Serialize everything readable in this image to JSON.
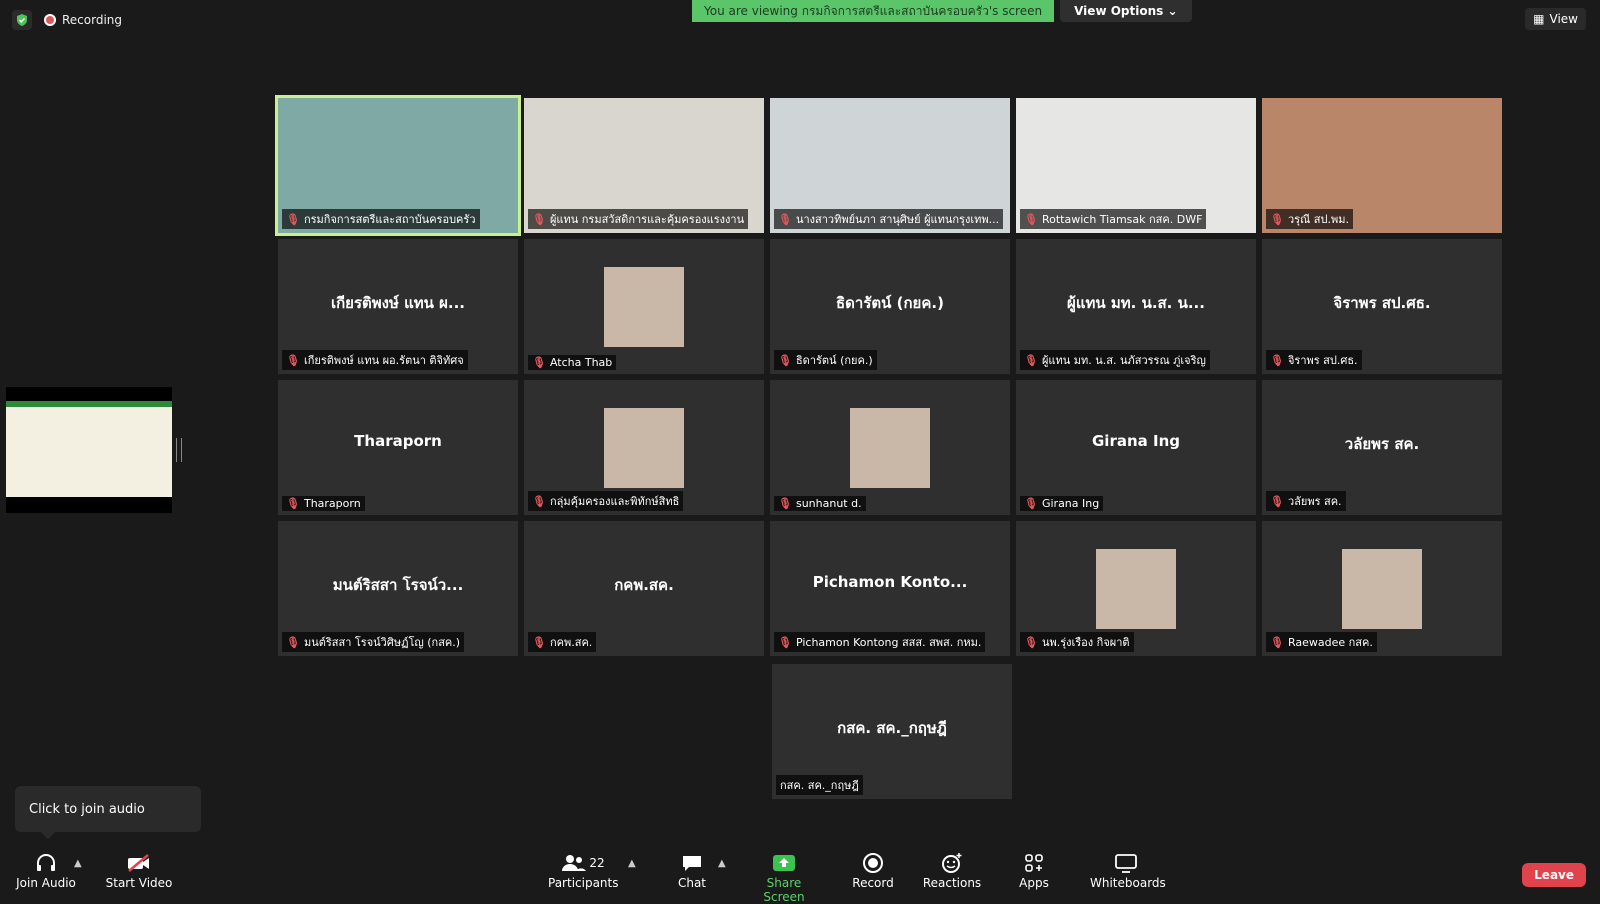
{
  "top": {
    "recording_label": "Recording",
    "banner_message": "You are viewing กรมกิจการสตรีและสถาบันครอบครัว's screen",
    "view_options_label": "View Options",
    "view_label": "View"
  },
  "tiles": [
    {
      "label": "กรมกิจการสตรีและสถาบันครอบครัว",
      "big": "",
      "kind": "video"
    },
    {
      "label": "ผู้แทน กรมสวัสดิการและคุ้มครองแรงงาน",
      "big": "",
      "kind": "video"
    },
    {
      "label": "นางสาวทิพย์นภา สานุศิษย์ ผู้แทนกรุงเทพ...",
      "big": "",
      "kind": "video"
    },
    {
      "label": "Rottawich Tiamsak กสค. DWF",
      "big": "",
      "kind": "video"
    },
    {
      "label": "วรุณี สป.พม.",
      "big": "",
      "kind": "video"
    },
    {
      "label": "เกียรติพงษ์ แทน ผอ.รัตนา ติจิทัศจ",
      "big": "เกียรติพงษ์ แทน ผ...",
      "kind": "name"
    },
    {
      "label": "Atcha Thab",
      "big": "",
      "kind": "avatar"
    },
    {
      "label": "ธิดารัตน์ (กยค.)",
      "big": "ธิดารัตน์ (กยค.)",
      "kind": "name"
    },
    {
      "label": "ผู้แทน มท. น.ส. นภัสวรรณ ภู่เจริญ",
      "big": "ผู้แทน มท. น.ส. น...",
      "kind": "name"
    },
    {
      "label": "จิราพร สป.ศธ.",
      "big": "จิราพร สป.ศธ.",
      "kind": "name"
    },
    {
      "label": "Tharaporn",
      "big": "Tharaporn",
      "kind": "name"
    },
    {
      "label": "กลุ่มคุ้มครองและพิทักษ์สิทธิ",
      "big": "",
      "kind": "avatar"
    },
    {
      "label": "sunhanut d.",
      "big": "",
      "kind": "avatar"
    },
    {
      "label": "Girana Ing",
      "big": "Girana Ing",
      "kind": "name"
    },
    {
      "label": "วลัยพร สค.",
      "big": "วลัยพร สค.",
      "kind": "name"
    },
    {
      "label": "มนต์ริสสา โรจน์วิศิษฏ์โญ (กสค.)",
      "big": "มนต์ริสสา โรจน์ว...",
      "kind": "name"
    },
    {
      "label": "กคพ.สค.",
      "big": "กคพ.สค.",
      "kind": "name"
    },
    {
      "label": "Pichamon Kontong สสส. สพส. กหม.",
      "big": "Pichamon Konto...",
      "kind": "name"
    },
    {
      "label": "นพ.รุ่งเรือง กิจผาติ",
      "big": "",
      "kind": "avatar"
    },
    {
      "label": "Raewadee กสค.",
      "big": "",
      "kind": "avatar"
    }
  ],
  "last_tile": {
    "label": "กสค. สค._กฤษฎี",
    "big": "กสค. สค._กฤษฎี"
  },
  "audio_tip": "Click to join audio",
  "toolbar": {
    "join_audio": "Join Audio",
    "start_video": "Start Video",
    "participants": "Participants",
    "participants_count": "22",
    "chat": "Chat",
    "share_screen": "Share Screen",
    "record": "Record",
    "reactions": "Reactions",
    "apps": "Apps",
    "whiteboards": "Whiteboards",
    "leave": "Leave"
  },
  "colors": {
    "accent_green": "#5bc56a",
    "leave_red": "#e0434b",
    "active_border": "#c8f08c"
  }
}
